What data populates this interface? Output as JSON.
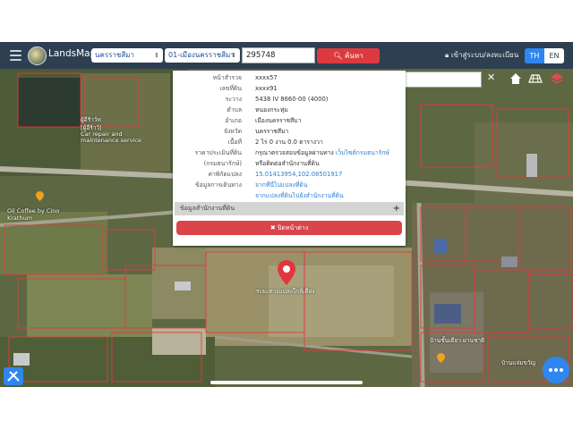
{
  "header": {
    "brand": "LandsMaps",
    "province": "นครราชสีมา",
    "office": "01-เมืองนครราชสีมา",
    "parcel_number": "295748",
    "search_button": "ค้นหา",
    "login": "เข้าสู่ระบบ/ลงทะเบียน",
    "lang_th": "TH",
    "lang_en": "EN"
  },
  "map_search": {
    "placeholder": "ค้นหาสถานที่สำคัญ"
  },
  "map_labels": {
    "poi_top": "ผู้อีร้าว์ท",
    "poi_top_sub": "[ผู้อีร้าว์]",
    "car_repair": "Car repair and maintenance service",
    "coffee": "Oil Coffee by Cino Krathum",
    "pin_label": "ระยะทางแปลงใกล้เคียง",
    "bottom_right_1": "บ้านชั้นเดียว ผ่านชาติ",
    "bottom_right_2": "บ้านแจ่มขวัญ"
  },
  "parcel_info": {
    "rows": [
      {
        "label": "หน้าสำรวจ",
        "value": "xxxx57"
      },
      {
        "label": "เลขที่ดิน",
        "value": "xxxx91"
      },
      {
        "label": "ระวาง",
        "value": "5438 IV 8660-00 (4000)"
      },
      {
        "label": "ตำบล",
        "value": "หนองกระทุ่ม"
      },
      {
        "label": "อำเภอ",
        "value": "เมืองนครราชสีมา"
      },
      {
        "label": "จังหวัด",
        "value": "นครราชสีมา"
      },
      {
        "label": "เนื้อที่",
        "value": "2 ไร่ 0 งาน 0.0 ตารางวา"
      },
      {
        "label": "ราคาประเมินที่ดิน",
        "value": "กรุณาตรวจสอบข้อมูลผ่านทาง",
        "link": "เว็บไซต์กรมธนารักษ์"
      },
      {
        "label": "(กรมธนารักษ์)",
        "value": "หรือติดต่อสำนักงานที่ดิน"
      },
      {
        "label": "ค่าพิกัดแปลง",
        "value": "15.01413954,102.08501917"
      },
      {
        "label": "ข้อมูลการเดินทาง",
        "value": "จากที่นี่ไปแปลงที่ดิน"
      },
      {
        "label": "",
        "value": "จากแปลงที่ดินไปยังสำนักงานที่ดิน"
      }
    ],
    "section_label": "ข้อมูลสำนักงานที่ดิน",
    "close_button": "ปิดหน้าต่าง"
  },
  "colors": {
    "header": "#2e3f51",
    "accent_red": "#dc3a3f",
    "link_blue": "#2e7dd1",
    "fab_blue": "#2f86f0"
  }
}
